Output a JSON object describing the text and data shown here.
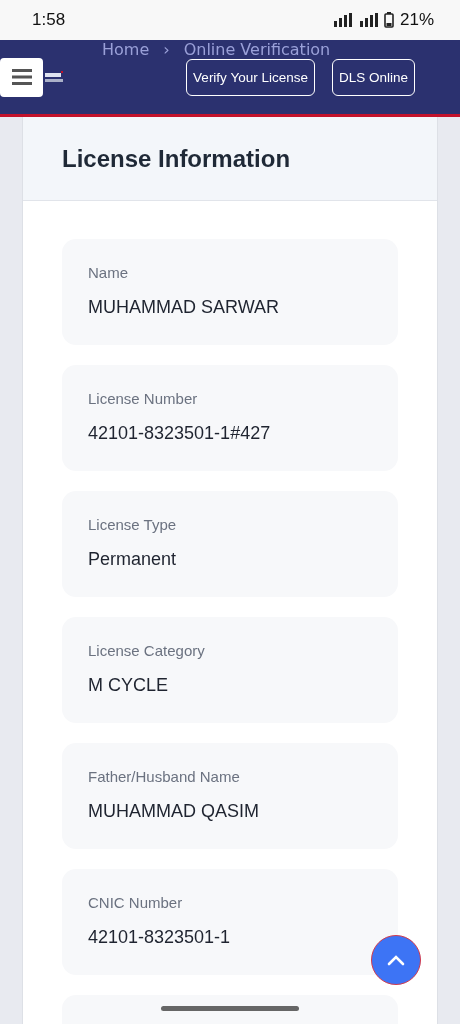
{
  "status_bar": {
    "time": "1:58",
    "battery": "21%"
  },
  "header": {
    "breadcrumb": [
      "Home",
      "›",
      "Online Verification"
    ],
    "buttons": [
      "Verify Your License",
      "DLS Online"
    ]
  },
  "section": {
    "title": "License Information",
    "fields": [
      {
        "label": "Name",
        "value": "MUHAMMAD SARWAR"
      },
      {
        "label": "License Number",
        "value": "42101-8323501-1#427"
      },
      {
        "label": "License Type",
        "value": "Permanent"
      },
      {
        "label": "License Category",
        "value": "M CYCLE"
      },
      {
        "label": "Father/Husband Name",
        "value": "MUHAMMAD QASIM"
      },
      {
        "label": "CNIC Number",
        "value": "42101-8323501-1"
      }
    ]
  }
}
